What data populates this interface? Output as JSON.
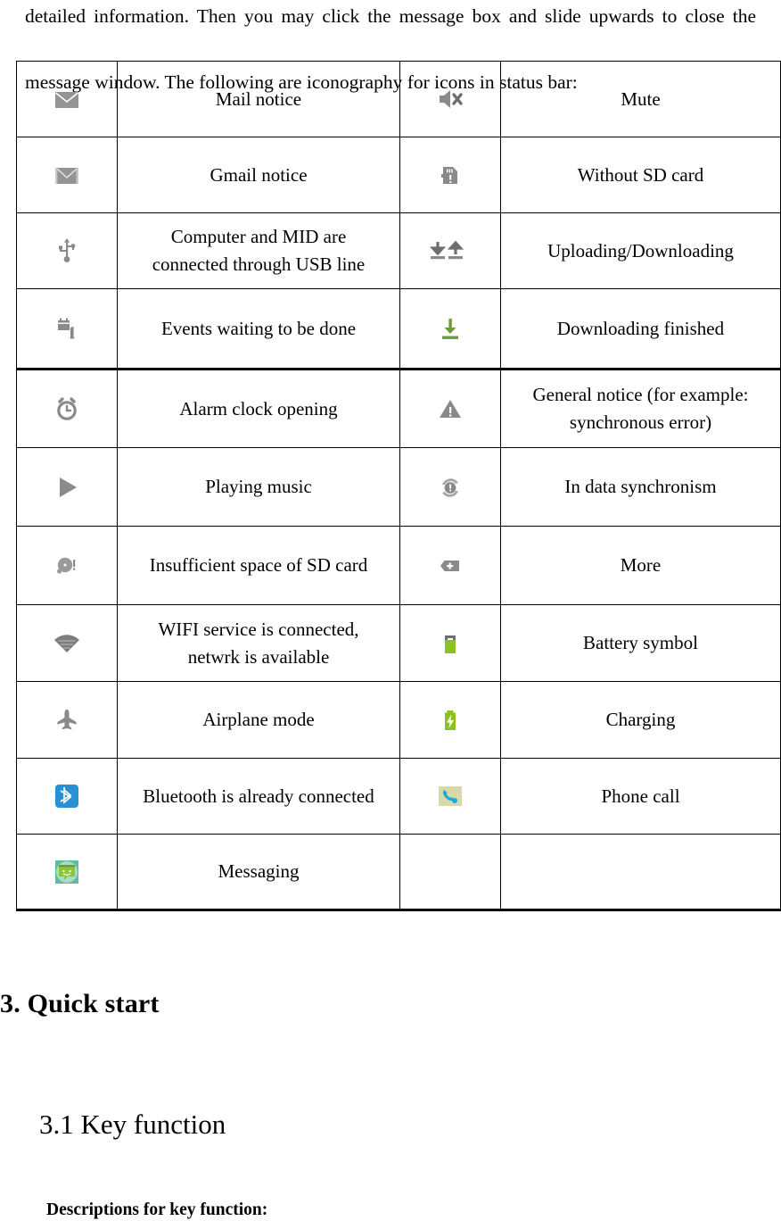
{
  "document": {
    "intro": {
      "line1": "detailed information. Then you may click the message box and slide upwards to close the",
      "line2": "message window. The following are iconography for icons in status bar:"
    },
    "headings": {
      "section": "3. Quick start",
      "subsection": "3.1 Key function",
      "descriptions": "Descriptions for key function:"
    },
    "colors": {
      "icon_gray": "#8a8a8a",
      "icon_dark_gray": "#6e6e6e",
      "download_green": "#6f9c34",
      "battery_green": "#8bc220",
      "bluetooth_blue": "#2b8fd4",
      "messaging_green": "#8cc63f",
      "messaging_teal": "#5dbd9c",
      "phone_blue": "#1fa8dd",
      "phone_bg": "#d9d8a8"
    },
    "table": {
      "rows": [
        {
          "icon_left": "mail-envelope-icon",
          "label_left": "Mail notice",
          "icon_right": "mute-speaker-icon",
          "label_right": "Mute"
        },
        {
          "icon_left": "gmail-envelope-icon",
          "label_left": "Gmail notice",
          "icon_right": "sd-card-missing-icon",
          "label_right": "Without SD card"
        },
        {
          "icon_left": "usb-icon",
          "label_left": "Computer and MID are connected through USB line",
          "label_left_line1": "Computer and MID are",
          "label_left_line2": "connected through USB line",
          "icon_right": "upload-download-arrows-icon",
          "label_right": "Uploading/Downloading"
        },
        {
          "icon_left": "calendar-event-icon",
          "label_left": "Events waiting to be done",
          "icon_right": "download-complete-icon",
          "label_right": "Downloading finished"
        },
        {
          "icon_left": "alarm-clock-icon",
          "label_left": "Alarm clock opening",
          "icon_right": "warning-triangle-icon",
          "label_right": "General notice (for example: synchronous error)",
          "label_right_line1": "General notice (for example:",
          "label_right_line2": "synchronous error)"
        },
        {
          "icon_left": "play-music-icon",
          "label_left": "Playing music",
          "icon_right": "sync-icon",
          "label_right": "In data synchronism"
        },
        {
          "icon_left": "sd-card-full-icon",
          "label_left": "Insufficient space of SD card",
          "icon_right": "more-plus-icon",
          "label_right": "More"
        },
        {
          "icon_left": "wifi-icon",
          "label_left": "WIFI service is connected, netwrk is available",
          "label_left_line1": "WIFI service is connected,",
          "label_left_line2": "netwrk is available",
          "icon_right": "battery-icon",
          "label_right": "Battery symbol"
        },
        {
          "icon_left": "airplane-icon",
          "label_left": "Airplane mode",
          "icon_right": "battery-charging-icon",
          "label_right": "Charging"
        },
        {
          "icon_left": "bluetooth-icon",
          "label_left": "Bluetooth is already connected",
          "icon_right": "phone-call-icon",
          "label_right": "Phone call"
        },
        {
          "icon_left": "messaging-icon",
          "label_left": "Messaging",
          "icon_right": "",
          "label_right": ""
        }
      ]
    }
  }
}
